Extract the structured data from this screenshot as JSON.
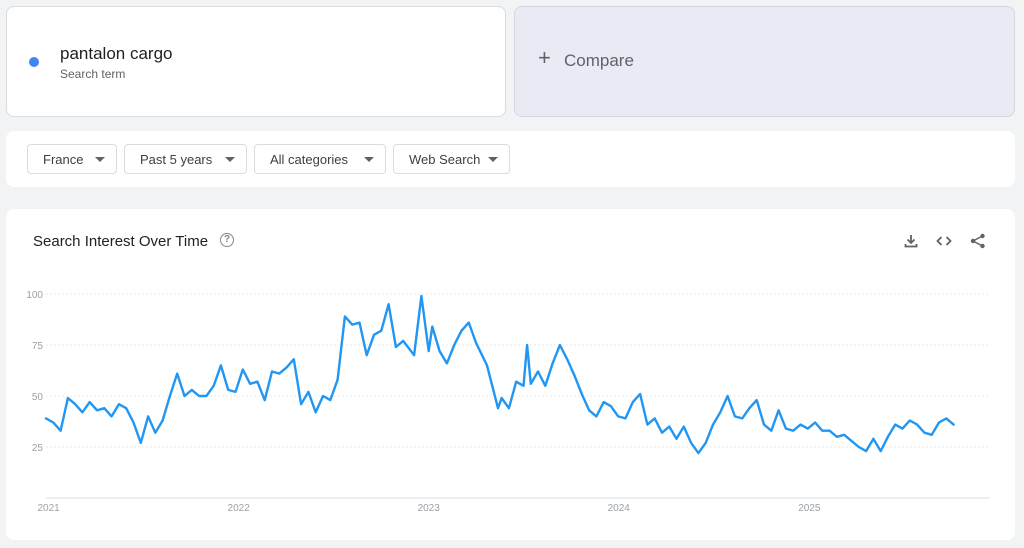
{
  "search_term": {
    "name": "pantalon cargo",
    "sublabel": "Search term",
    "color": "#4285f4"
  },
  "compare": {
    "label": "Compare",
    "icon": "plus-icon"
  },
  "filters": {
    "region": "France",
    "time_range": "Past 5 years",
    "category": "All categories",
    "search_type": "Web Search"
  },
  "chart_panel": {
    "title": "Search Interest Over Time",
    "icons": [
      "help-icon",
      "download-icon",
      "embed-icon",
      "share-icon"
    ]
  },
  "chart_data": {
    "type": "line",
    "title": "Search Interest Over Time",
    "ylim": [
      0,
      100
    ],
    "y_ticks": [
      25,
      50,
      75,
      100
    ],
    "x_ticks": [
      "2021",
      "2022",
      "2023",
      "2024",
      "2025"
    ],
    "grid": true,
    "x_range": [
      "2020-12-27",
      "2025-12-14"
    ],
    "series": [
      {
        "color": "#2196f3",
        "points": [
          [
            "2020-12-27",
            39
          ],
          [
            "2021-01-10",
            37
          ],
          [
            "2021-01-24",
            33
          ],
          [
            "2021-02-07",
            49
          ],
          [
            "2021-02-21",
            46
          ],
          [
            "2021-03-07",
            42
          ],
          [
            "2021-03-21",
            47
          ],
          [
            "2021-04-04",
            43
          ],
          [
            "2021-04-18",
            44
          ],
          [
            "2021-05-02",
            40
          ],
          [
            "2021-05-16",
            46
          ],
          [
            "2021-05-30",
            44
          ],
          [
            "2021-06-13",
            37
          ],
          [
            "2021-06-27",
            27
          ],
          [
            "2021-07-11",
            40
          ],
          [
            "2021-07-25",
            32
          ],
          [
            "2021-08-08",
            38
          ],
          [
            "2021-08-22",
            50
          ],
          [
            "2021-09-05",
            61
          ],
          [
            "2021-09-19",
            50
          ],
          [
            "2021-10-03",
            53
          ],
          [
            "2021-10-17",
            50
          ],
          [
            "2021-10-31",
            50
          ],
          [
            "2021-11-14",
            55
          ],
          [
            "2021-11-28",
            65
          ],
          [
            "2021-12-12",
            53
          ],
          [
            "2021-12-26",
            52
          ],
          [
            "2022-01-09",
            63
          ],
          [
            "2022-01-23",
            56
          ],
          [
            "2022-02-06",
            57
          ],
          [
            "2022-02-20",
            48
          ],
          [
            "2022-03-06",
            62
          ],
          [
            "2022-03-20",
            61
          ],
          [
            "2022-04-03",
            64
          ],
          [
            "2022-04-17",
            68
          ],
          [
            "2022-05-01",
            46
          ],
          [
            "2022-05-15",
            52
          ],
          [
            "2022-05-29",
            42
          ],
          [
            "2022-06-12",
            50
          ],
          [
            "2022-06-26",
            48
          ],
          [
            "2022-07-10",
            58
          ],
          [
            "2022-07-24",
            89
          ],
          [
            "2022-08-07",
            85
          ],
          [
            "2022-08-21",
            86
          ],
          [
            "2022-09-04",
            70
          ],
          [
            "2022-09-18",
            80
          ],
          [
            "2022-10-02",
            82
          ],
          [
            "2022-10-16",
            95
          ],
          [
            "2022-10-30",
            74
          ],
          [
            "2022-11-13",
            77
          ],
          [
            "2022-12-04",
            70
          ],
          [
            "2022-12-18",
            99
          ],
          [
            "2023-01-01",
            72
          ],
          [
            "2023-01-08",
            84
          ],
          [
            "2023-01-22",
            72
          ],
          [
            "2023-02-05",
            66
          ],
          [
            "2023-02-19",
            75
          ],
          [
            "2023-03-05",
            82
          ],
          [
            "2023-03-19",
            86
          ],
          [
            "2023-04-02",
            76
          ],
          [
            "2023-04-23",
            65
          ],
          [
            "2023-05-14",
            44
          ],
          [
            "2023-05-21",
            49
          ],
          [
            "2023-06-04",
            44
          ],
          [
            "2023-06-18",
            57
          ],
          [
            "2023-07-02",
            55
          ],
          [
            "2023-07-09",
            75
          ],
          [
            "2023-07-16",
            56
          ],
          [
            "2023-07-30",
            62
          ],
          [
            "2023-08-13",
            55
          ],
          [
            "2023-08-27",
            66
          ],
          [
            "2023-09-10",
            75
          ],
          [
            "2023-09-24",
            68
          ],
          [
            "2023-10-08",
            60
          ],
          [
            "2023-10-22",
            51
          ],
          [
            "2023-11-05",
            43
          ],
          [
            "2023-11-19",
            40
          ],
          [
            "2023-12-03",
            47
          ],
          [
            "2023-12-17",
            45
          ],
          [
            "2023-12-31",
            40
          ],
          [
            "2024-01-14",
            39
          ],
          [
            "2024-01-28",
            47
          ],
          [
            "2024-02-11",
            51
          ],
          [
            "2024-02-25",
            36
          ],
          [
            "2024-03-10",
            39
          ],
          [
            "2024-03-24",
            32
          ],
          [
            "2024-04-07",
            35
          ],
          [
            "2024-04-21",
            29
          ],
          [
            "2024-05-05",
            35
          ],
          [
            "2024-05-19",
            27
          ],
          [
            "2024-06-02",
            22
          ],
          [
            "2024-06-16",
            27
          ],
          [
            "2024-06-30",
            36
          ],
          [
            "2024-07-14",
            42
          ],
          [
            "2024-07-28",
            50
          ],
          [
            "2024-08-11",
            40
          ],
          [
            "2024-08-25",
            39
          ],
          [
            "2024-09-08",
            44
          ],
          [
            "2024-09-22",
            48
          ],
          [
            "2024-10-06",
            36
          ],
          [
            "2024-10-20",
            33
          ],
          [
            "2024-11-03",
            43
          ],
          [
            "2024-11-17",
            34
          ],
          [
            "2024-12-01",
            33
          ],
          [
            "2024-12-15",
            36
          ],
          [
            "2024-12-29",
            34
          ],
          [
            "2025-01-12",
            37
          ],
          [
            "2025-01-26",
            33
          ],
          [
            "2025-02-09",
            33
          ],
          [
            "2025-02-23",
            30
          ],
          [
            "2025-03-09",
            31
          ],
          [
            "2025-03-23",
            28
          ],
          [
            "2025-04-06",
            25
          ],
          [
            "2025-04-20",
            23
          ],
          [
            "2025-05-04",
            29
          ],
          [
            "2025-05-18",
            23
          ],
          [
            "2025-06-01",
            30
          ],
          [
            "2025-06-15",
            36
          ],
          [
            "2025-06-29",
            34
          ],
          [
            "2025-07-13",
            38
          ],
          [
            "2025-07-27",
            36
          ],
          [
            "2025-08-10",
            32
          ],
          [
            "2025-08-24",
            31
          ],
          [
            "2025-09-07",
            37
          ],
          [
            "2025-09-21",
            39
          ],
          [
            "2025-10-05",
            36
          ]
        ]
      }
    ]
  }
}
